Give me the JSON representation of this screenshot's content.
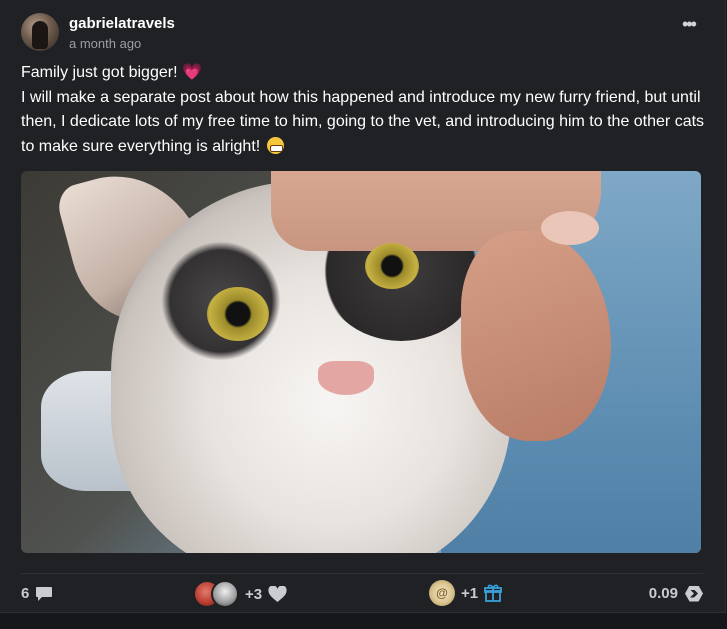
{
  "post": {
    "author": "gabrielatravels",
    "time_ago": "a month ago",
    "menu_icon": "more-horizontal-icon",
    "paragraph1": "Family just got bigger! ",
    "paragraph2": "I will make a separate post about how this happened and introduce my new furry friend, but until then, I dedicate lots of my free time to him, going to the vet, and introducing him to the other cats to make sure everything is alright! ",
    "emoji_heart": "💗",
    "image_icon": "cat-photo"
  },
  "footer": {
    "comment_count": "6",
    "comment_icon": "speech-bubble-icon",
    "extra_voters": "+3",
    "vote_icon": "heart-icon",
    "extra_tippers": "+1",
    "tip_icon": "gift-icon",
    "tipper_badge": "@",
    "payout": "0.09",
    "payout_icon": "hive-logo-icon"
  },
  "colors": {
    "background": "#1f2125",
    "page": "#15171b",
    "text": "#ffffff",
    "muted": "#9a9ea5",
    "gift_icon": "#3aa0d8"
  }
}
